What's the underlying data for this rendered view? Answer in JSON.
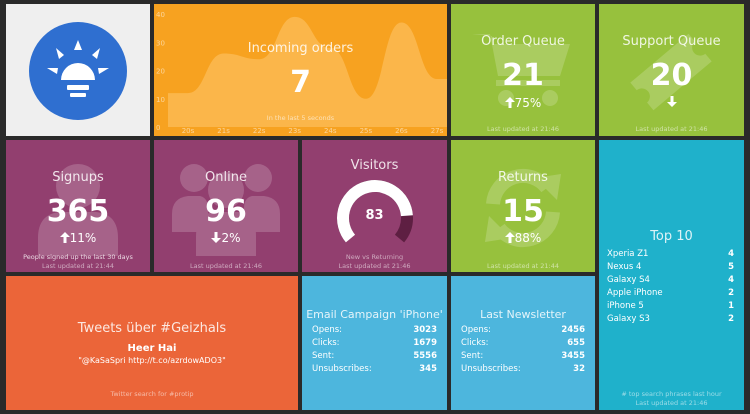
{
  "colors": {
    "background": "#2a2a2a",
    "logo_tile": "#efefef",
    "logo_blue": "#2f6fd0",
    "orange": "#f7a220",
    "green": "#97c13d",
    "purple": "#923f6f",
    "teal": "#1fb1cb",
    "red_orange": "#eb6539",
    "light_blue": "#4db6dd",
    "meter_dark": "#5e1f42"
  },
  "logo": {
    "icon": "sun-bulb-logo-icon"
  },
  "incoming": {
    "title": "Incoming orders",
    "value": "7",
    "more": "In the last 5 seconds",
    "ylabels": [
      "40",
      "30",
      "20",
      "10",
      "0"
    ],
    "xlabels": [
      "20s",
      "21s",
      "22s",
      "23s",
      "24s",
      "25s",
      "26s",
      "27s"
    ]
  },
  "chart_data": {
    "type": "area",
    "x": [
      "20s",
      "21s",
      "22s",
      "23s",
      "24s",
      "25s",
      "26s",
      "27s"
    ],
    "values": [
      12,
      26,
      24,
      39,
      28,
      10,
      37,
      17
    ],
    "ylim": [
      0,
      40
    ],
    "ytick_labels": [
      "40",
      "30",
      "20",
      "10",
      "0"
    ],
    "xlabel": "",
    "ylabel": ""
  },
  "order_queue": {
    "title": "Order Queue",
    "value": "21",
    "change": "75%",
    "change_icon": "arrow-up-icon",
    "updated": "Last updated at 21:46",
    "icon": "shopping-cart-icon"
  },
  "support_queue": {
    "title": "Support Queue",
    "value": "20",
    "change_icon": "arrow-down-icon",
    "updated": "Last updated at 21:46",
    "icon": "ticket-icon"
  },
  "signups": {
    "title": "Signups",
    "value": "365",
    "change": "11%",
    "change_icon": "arrow-up-icon",
    "more": "People signed up the last 30 days",
    "updated": "Last updated at 21:44",
    "icon": "user-icon"
  },
  "online": {
    "title": "Online",
    "value": "96",
    "change": "2%",
    "change_icon": "arrow-down-icon",
    "updated": "Last updated at 21:46",
    "icon": "users-icon"
  },
  "visitors": {
    "title": "Visitors",
    "value": "83",
    "meter_max": 100,
    "more": "New vs Returning",
    "updated": "Last updated at 21:46"
  },
  "returns": {
    "title": "Returns",
    "value": "15",
    "change": "88%",
    "change_icon": "arrow-up-icon",
    "updated": "Last updated at 21:44",
    "icon": "refresh-icon"
  },
  "top10": {
    "title": "Top 10",
    "items": [
      {
        "label": "Xperia Z1",
        "value": "4"
      },
      {
        "label": "Nexus 4",
        "value": "5"
      },
      {
        "label": "Galaxy S4",
        "value": "4"
      },
      {
        "label": "Apple iPhone",
        "value": "2"
      },
      {
        "label": "iPhone 5",
        "value": "1"
      },
      {
        "label": "Galaxy S3",
        "value": "2"
      }
    ],
    "more": "# top search phrases last hour",
    "updated": "Last updated at 21:46"
  },
  "tweets": {
    "title": "Tweets über #Geizhals",
    "author": "Heer Hai",
    "text": "\"@KaSaSpri http://t.co/azrdowADO3\"",
    "more": "Twitter search for #protip"
  },
  "email": {
    "title": "Email Campaign 'iPhone'",
    "items": [
      {
        "label": "Opens:",
        "value": "3023"
      },
      {
        "label": "Clicks:",
        "value": "1679"
      },
      {
        "label": "Sent:",
        "value": "5556"
      },
      {
        "label": "Unsubscribes:",
        "value": "345"
      }
    ]
  },
  "newsletter": {
    "title": "Last Newsletter",
    "items": [
      {
        "label": "Opens:",
        "value": "2456"
      },
      {
        "label": "Clicks:",
        "value": "655"
      },
      {
        "label": "Sent:",
        "value": "3455"
      },
      {
        "label": "Unsubscribes:",
        "value": "32"
      }
    ]
  }
}
